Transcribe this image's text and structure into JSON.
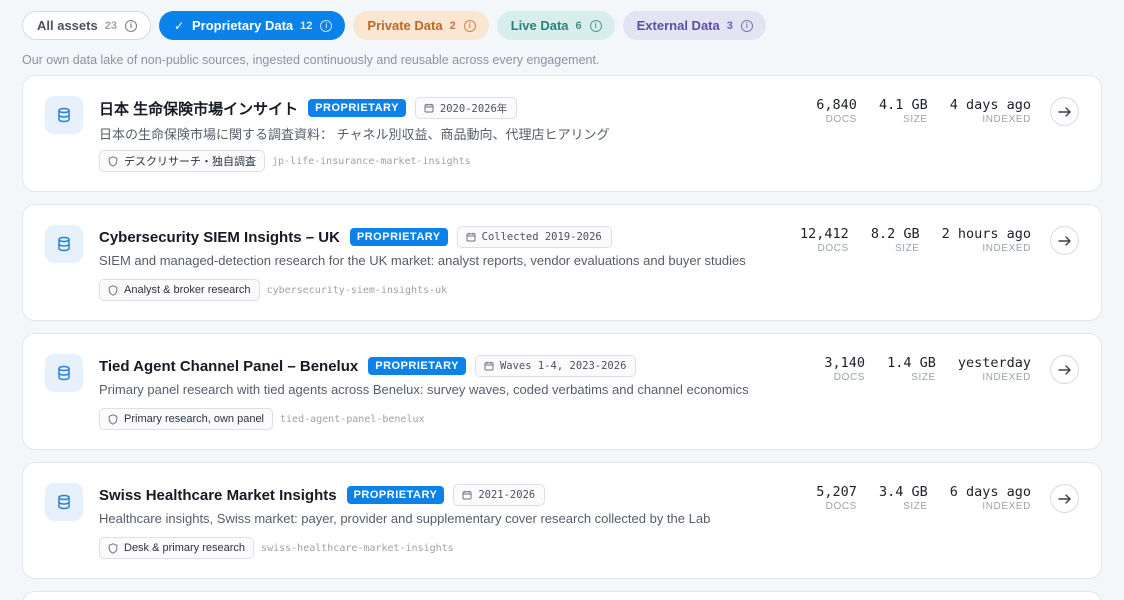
{
  "filters": [
    {
      "label": "All assets",
      "count": "23",
      "variant": "all"
    },
    {
      "label": "Proprietary Data",
      "count": "12",
      "variant": "prop",
      "selected": true
    },
    {
      "label": "Private Data",
      "count": "2",
      "variant": "priv"
    },
    {
      "label": "Live Data",
      "count": "6",
      "variant": "live"
    },
    {
      "label": "External Data",
      "count": "3",
      "variant": "ext"
    }
  ],
  "subtitle": "Our own data lake of non-public sources, ingested continuously and reusable across every engagement.",
  "stat_labels": {
    "docs": "DOCS",
    "size": "SIZE",
    "indexed": "INDEXED"
  },
  "assets": [
    {
      "title": "日本 生命保険市場インサイト",
      "badge": "PROPRIETARY",
      "period": "2020-2026年",
      "description": "日本の生命保険市場に関する調査資料： チャネル別収益、商品動向、代理店ヒアリング",
      "source": "デスクリサーチ・独自調査",
      "slug": "jp-life-insurance-market-insights",
      "docs": "6,840",
      "size": "4.1 GB",
      "indexed": "4 days ago"
    },
    {
      "title": "Cybersecurity SIEM Insights – UK",
      "badge": "PROPRIETARY",
      "period": "Collected 2019-2026",
      "description": "SIEM and managed-detection research for the UK market: analyst reports, vendor evaluations and buyer studies",
      "source": "Analyst & broker research",
      "slug": "cybersecurity-siem-insights-uk",
      "docs": "12,412",
      "size": "8.2 GB",
      "indexed": "2 hours ago"
    },
    {
      "title": "Tied Agent Channel Panel – Benelux",
      "badge": "PROPRIETARY",
      "period": "Waves 1-4, 2023-2026",
      "description": "Primary panel research with tied agents across Benelux: survey waves, coded verbatims and channel economics",
      "source": "Primary research, own panel",
      "slug": "tied-agent-panel-benelux",
      "docs": "3,140",
      "size": "1.4 GB",
      "indexed": "yesterday"
    },
    {
      "title": "Swiss Healthcare Market Insights",
      "badge": "PROPRIETARY",
      "period": "2021-2026",
      "description": "Healthcare insights, Swiss market: payer, provider and supplementary cover research collected by the Lab",
      "source": "Desk & primary research",
      "slug": "swiss-healthcare-market-insights",
      "docs": "5,207",
      "size": "3.4 GB",
      "indexed": "6 days ago"
    }
  ]
}
